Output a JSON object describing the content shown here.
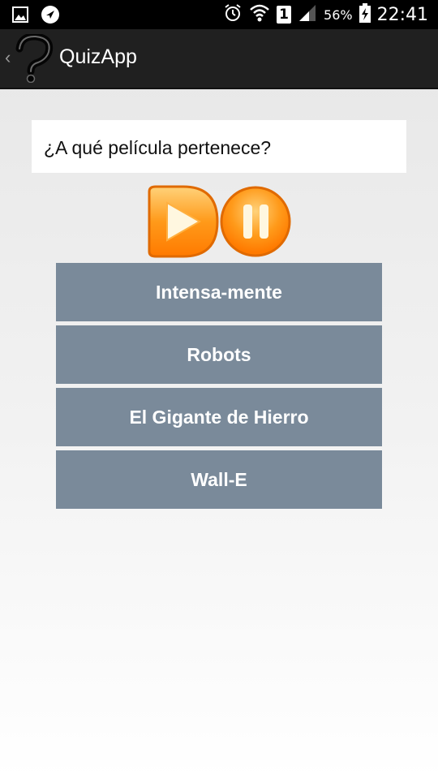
{
  "status_bar": {
    "icons_left": [
      "image-icon",
      "navigation-icon"
    ],
    "icons_right": [
      "alarm-icon",
      "wifi-icon",
      "sim-badge",
      "signal-icon",
      "battery-icon"
    ],
    "sim_label": "1",
    "battery_percent": "56%",
    "time": "22:41"
  },
  "action_bar": {
    "title": "QuizApp",
    "logo_icon": "question-mark-icon"
  },
  "question": {
    "text": "¿A qué película pertenece?"
  },
  "media": {
    "play_icon": "play-icon",
    "pause_icon": "pause-icon",
    "accent": "#ff8c00"
  },
  "answers": [
    {
      "label": "Intensa-mente"
    },
    {
      "label": "Robots"
    },
    {
      "label": "El Gigante de Hierro"
    },
    {
      "label": "Wall-E"
    }
  ],
  "colors": {
    "answer_bg": "#7a8a9a",
    "action_bar_bg": "#202020"
  }
}
